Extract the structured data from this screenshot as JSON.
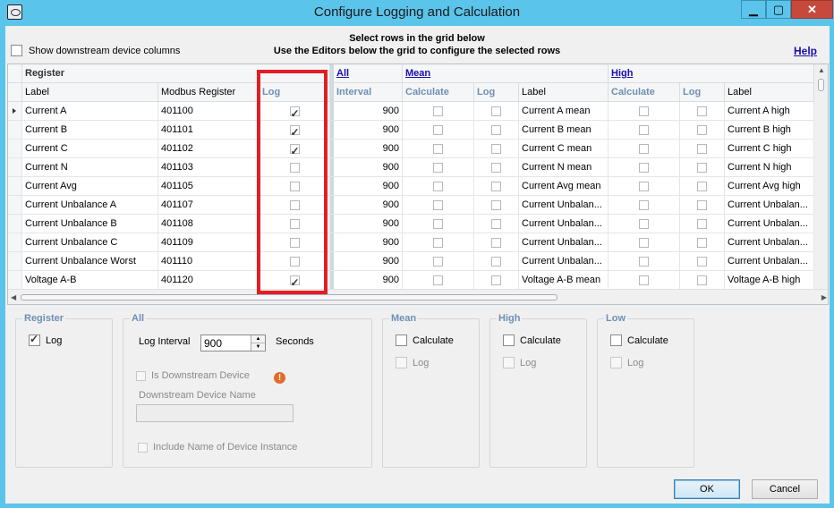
{
  "window": {
    "title": "Configure Logging and Calculation",
    "controls": [
      "▁",
      "▢",
      "✕"
    ]
  },
  "top": {
    "show_downstream_label": "Show downstream device columns",
    "instruction_line1": "Select rows in the grid below",
    "instruction_line2": "Use the Editors below the grid to configure the selected rows",
    "help_link": "Help"
  },
  "grid": {
    "groups": {
      "register": "Register",
      "all": "All",
      "mean": "Mean",
      "high": "High"
    },
    "columns": {
      "label": "Label",
      "modbus_register": "Modbus Register",
      "log": "Log",
      "interval": "Interval",
      "calculate": "Calculate",
      "mean_log": "Log",
      "mean_label": "Label",
      "high_calculate": "Calculate",
      "high_log": "Log",
      "high_label": "Label"
    },
    "rows": [
      {
        "label": "Current A",
        "modbus": "401100",
        "log": true,
        "interval": "900",
        "mean_label": "Current A mean",
        "high_label": "Current A high"
      },
      {
        "label": "Current B",
        "modbus": "401101",
        "log": true,
        "interval": "900",
        "mean_label": "Current B mean",
        "high_label": "Current B high"
      },
      {
        "label": "Current C",
        "modbus": "401102",
        "log": true,
        "interval": "900",
        "mean_label": "Current C mean",
        "high_label": "Current C high"
      },
      {
        "label": "Current N",
        "modbus": "401103",
        "log": false,
        "interval": "900",
        "mean_label": "Current N mean",
        "high_label": "Current N high"
      },
      {
        "label": "Current Avg",
        "modbus": "401105",
        "log": false,
        "interval": "900",
        "mean_label": "Current Avg mean",
        "high_label": "Current Avg high"
      },
      {
        "label": "Current Unbalance A",
        "modbus": "401107",
        "log": false,
        "interval": "900",
        "mean_label": "Current Unbalan...",
        "high_label": "Current Unbalan..."
      },
      {
        "label": "Current Unbalance B",
        "modbus": "401108",
        "log": false,
        "interval": "900",
        "mean_label": "Current Unbalan...",
        "high_label": "Current Unbalan..."
      },
      {
        "label": "Current Unbalance C",
        "modbus": "401109",
        "log": false,
        "interval": "900",
        "mean_label": "Current Unbalan...",
        "high_label": "Current Unbalan..."
      },
      {
        "label": "Current Unbalance Worst",
        "modbus": "401110",
        "log": false,
        "interval": "900",
        "mean_label": "Current Unbalan...",
        "high_label": "Current Unbalan..."
      },
      {
        "label": "Voltage A-B",
        "modbus": "401120",
        "log": true,
        "interval": "900",
        "mean_label": "Voltage A-B mean",
        "high_label": "Voltage A-B high"
      }
    ]
  },
  "editors": {
    "register": {
      "title": "Register",
      "log_label": "Log",
      "log_checked": true
    },
    "all": {
      "title": "All",
      "log_interval_label": "Log Interval",
      "log_interval_value": "900",
      "seconds_label": "Seconds",
      "is_downstream_label": "Is Downstream Device",
      "downstream_name_label": "Downstream Device Name",
      "include_name_label": "Include Name of Device Instance",
      "warning_glyph": "!"
    },
    "mean": {
      "title": "Mean",
      "calculate_label": "Calculate",
      "log_label": "Log"
    },
    "high": {
      "title": "High",
      "calculate_label": "Calculate",
      "log_label": "Log"
    },
    "low": {
      "title": "Low",
      "calculate_label": "Calculate",
      "log_label": "Log"
    }
  },
  "buttons": {
    "ok": "OK",
    "cancel": "Cancel"
  }
}
